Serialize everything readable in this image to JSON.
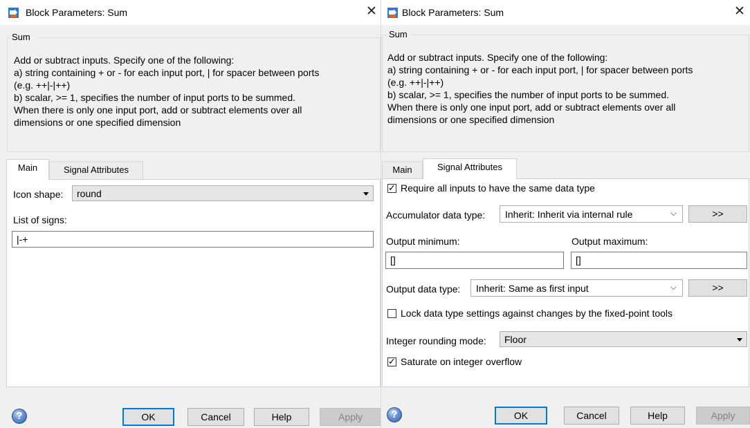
{
  "dialogs": [
    {
      "title": "Block Parameters: Sum",
      "close_glyph": "✕",
      "group_title": "Sum",
      "description": [
        "Add or subtract inputs.  Specify one of the following:",
        "a) string containing + or - for each input port, | for spacer between ports",
        "(e.g. ++|-|++)",
        "b) scalar, >= 1, specifies the number of input ports to be summed.",
        "When there is only one input port, add or subtract elements over all",
        "dimensions or one specified dimension"
      ],
      "tabs": [
        "Main",
        "Signal Attributes"
      ],
      "active_tab": "Main",
      "main": {
        "icon_shape_label": "Icon shape:",
        "icon_shape_value": "round",
        "list_of_signs_label": "List of signs:",
        "list_of_signs_value": "|-+"
      },
      "buttons": {
        "ok": "OK",
        "cancel": "Cancel",
        "help": "Help",
        "apply": "Apply"
      },
      "help_glyph": "?"
    },
    {
      "title": "Block Parameters: Sum",
      "close_glyph": "✕",
      "group_title": "Sum",
      "description": [
        "Add or subtract inputs.  Specify one of the following:",
        "a) string containing + or - for each input port, | for spacer between ports",
        "(e.g. ++|-|++)",
        "b) scalar, >= 1, specifies the number of input ports to be summed.",
        "When there is only one input port, add or subtract elements over all",
        "dimensions or one specified dimension"
      ],
      "tabs": [
        "Main",
        "Signal Attributes"
      ],
      "active_tab": "Signal Attributes",
      "signal": {
        "require_same_type_label": "Require all inputs to have the same data type",
        "require_same_type_checked": true,
        "accumulator_label": "Accumulator data type:",
        "accumulator_value": "Inherit: Inherit via internal rule",
        "assistant_button": ">>",
        "output_min_label": "Output minimum:",
        "output_min_value": "[]",
        "output_max_label": "Output maximum:",
        "output_max_value": "[]",
        "output_type_label": "Output data type:",
        "output_type_value": "Inherit: Same as first input",
        "lock_label": "Lock data type settings against changes by the fixed-point tools",
        "lock_checked": false,
        "rounding_label": "Integer rounding mode:",
        "rounding_value": "Floor",
        "saturate_label": "Saturate on integer overflow",
        "saturate_checked": true,
        "check_glyph": "✓",
        "dropdown_glyph": "⌵"
      },
      "buttons": {
        "ok": "OK",
        "cancel": "Cancel",
        "help": "Help",
        "apply": "Apply"
      },
      "help_glyph": "?"
    }
  ]
}
